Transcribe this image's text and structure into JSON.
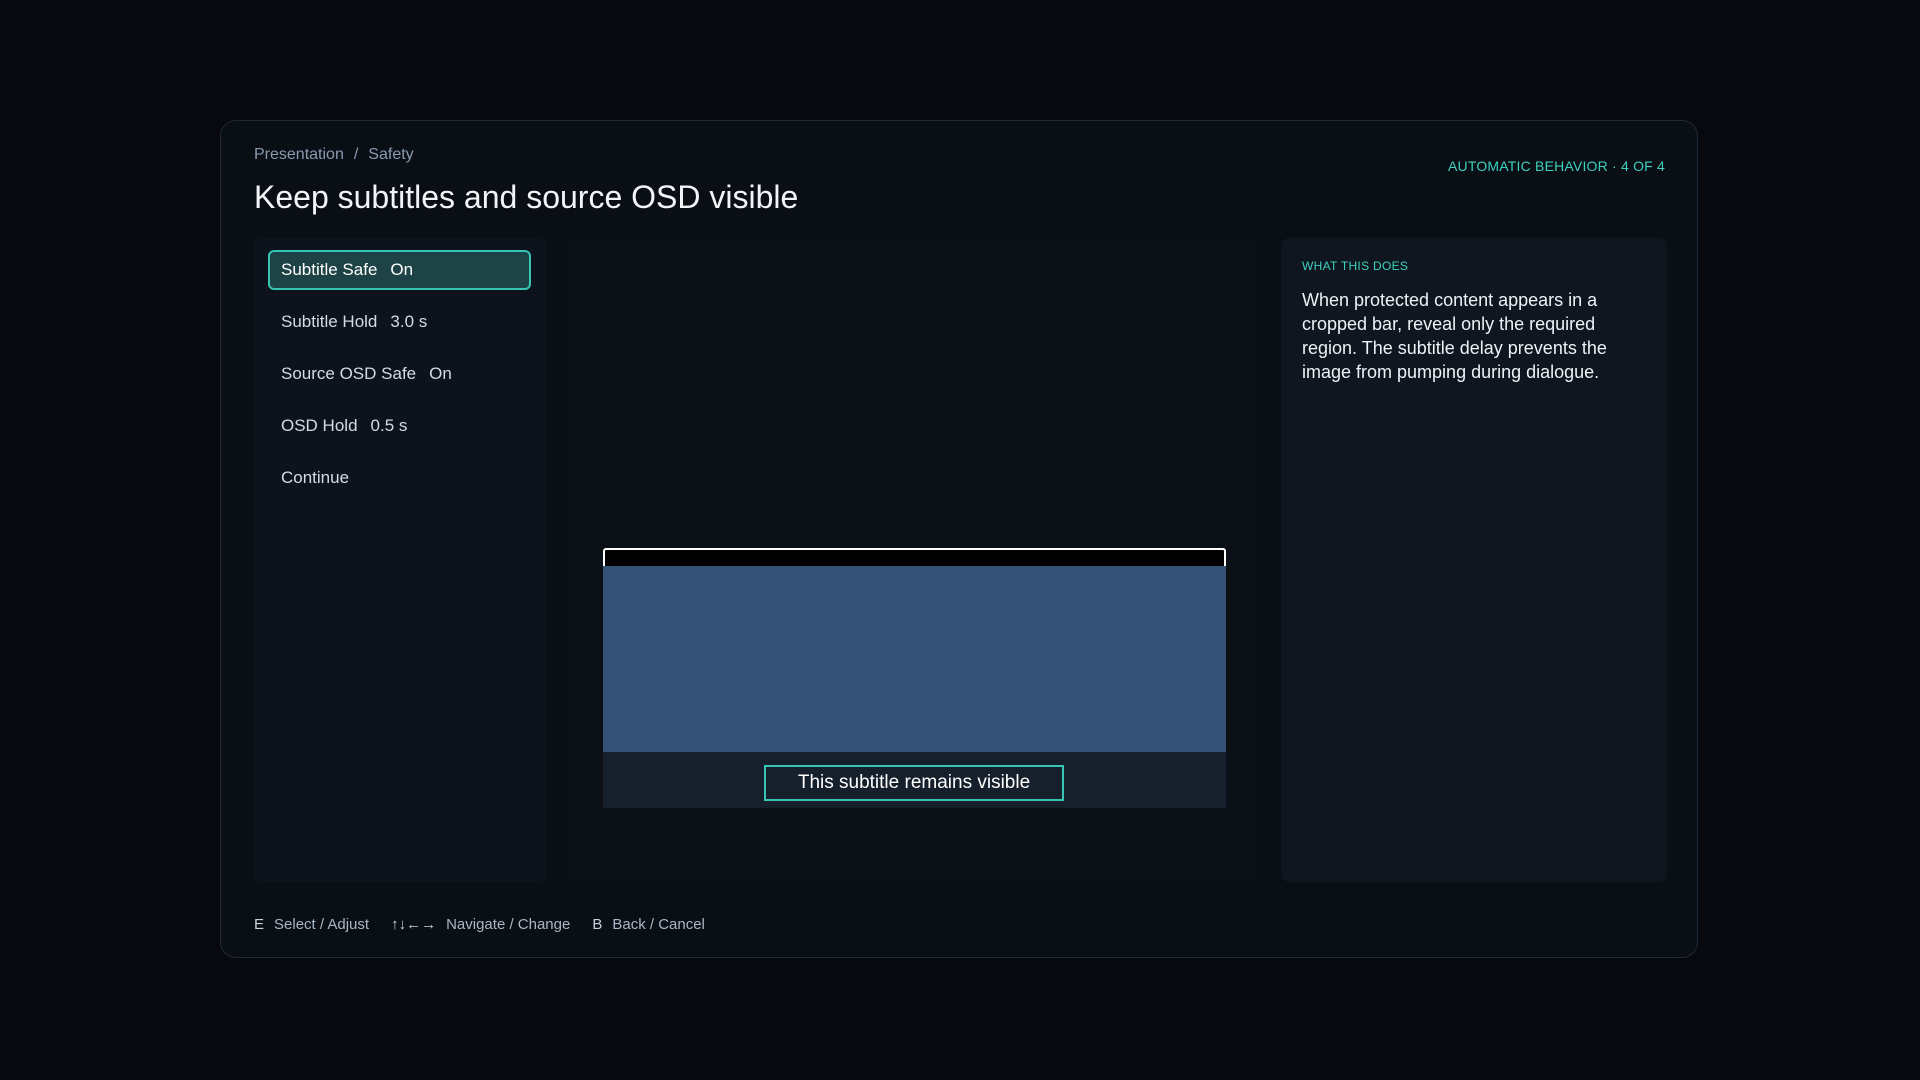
{
  "breadcrumb": {
    "items": [
      "Presentation",
      "Safety"
    ],
    "separator": "/"
  },
  "mode_label": "AUTOMATIC BEHAVIOR · 4 OF 4",
  "title": "Keep subtitles and source OSD visible",
  "menu": {
    "items": [
      {
        "label": "Subtitle Safe",
        "value": "On",
        "selected": true
      },
      {
        "label": "Subtitle Hold",
        "value": "3.0 s",
        "selected": false
      },
      {
        "label": "Source OSD Safe",
        "value": "On",
        "selected": false
      },
      {
        "label": "OSD Hold",
        "value": "0.5 s",
        "selected": false
      },
      {
        "label": "Continue",
        "value": "",
        "selected": false
      }
    ]
  },
  "preview": {
    "subtitle_text": "This subtitle remains visible"
  },
  "info": {
    "heading": "WHAT THIS DOES",
    "body": "When protected content appears in a cropped bar, reveal only the required region. The subtitle delay prevents the image from pumping during dialogue."
  },
  "hints": [
    {
      "key": "E",
      "label": "Select / Adjust"
    },
    {
      "key": "↑↓←→",
      "label": "Navigate / Change"
    },
    {
      "key": "B",
      "label": "Back / Cancel"
    }
  ],
  "colors": {
    "accent": "#37c6b4",
    "selected_bg": "#1e4346",
    "video_block": "#335275",
    "background": "#07090e"
  }
}
